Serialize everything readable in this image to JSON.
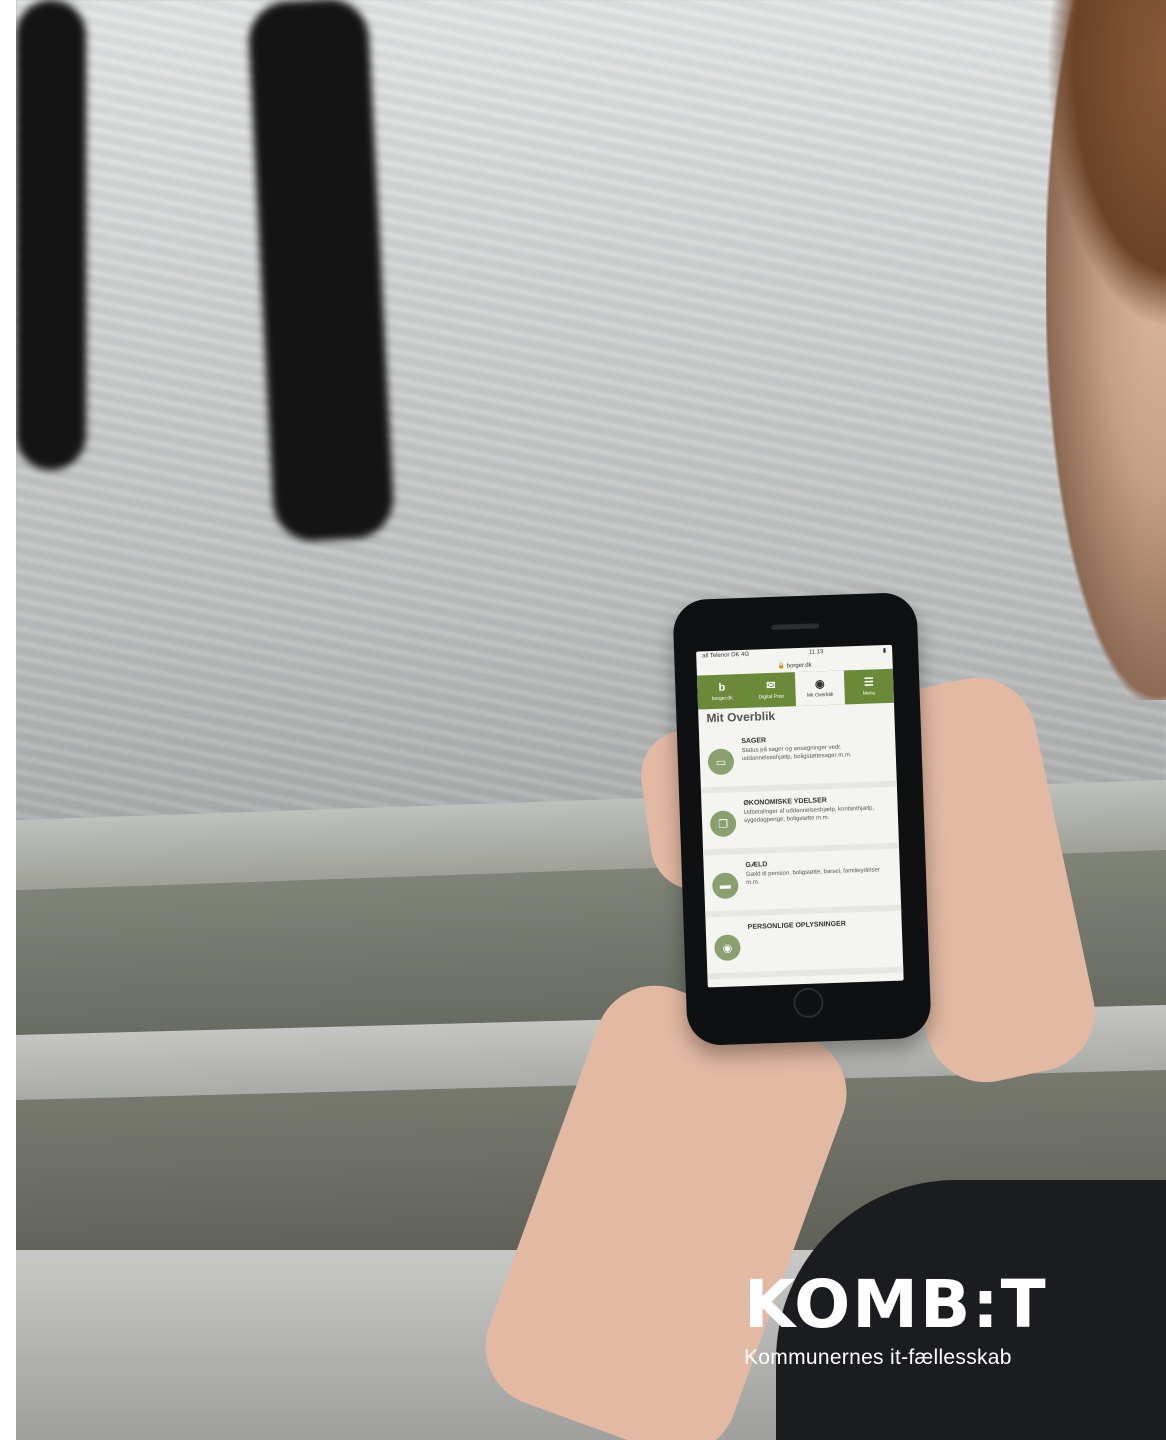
{
  "brand": {
    "logo_text": "KOMB:T",
    "tagline": "Kommunernes it-fællesskab"
  },
  "phone_screen": {
    "status_carrier": "all Telenor DK 4G",
    "status_time": "11.13",
    "url": "borger.dk",
    "nav": [
      {
        "label": "borger.dk",
        "icon": "b-logo-icon"
      },
      {
        "label": "Digital Post",
        "icon": "envelope-icon"
      },
      {
        "label": "Mit Overblik",
        "icon": "person-icon"
      },
      {
        "label": "Menu",
        "icon": "hamburger-icon"
      }
    ],
    "heading": "Mit Overblik",
    "cards": [
      {
        "title": "SAGER",
        "desc": "Status på sager og ansøgninger vedr. uddannelseshjælp, boligstøttesager m.m.",
        "icon": "folder-icon"
      },
      {
        "title": "ØKONOMISKE YDELSER",
        "desc": "Udbetalinger af uddannelseshjælp, kontanthjælp, sygedagpenge, boligstøtte m.m.",
        "icon": "coins-icon"
      },
      {
        "title": "GÆLD",
        "desc": "Gæld til pension, boligstøtte, barsel, familieydelser m.m.",
        "icon": "card-icon"
      },
      {
        "title": "PERSONLIGE OPLYSNINGER",
        "desc": "",
        "icon": "person-icon"
      }
    ]
  },
  "colors": {
    "nav_green": "#6a8a3a",
    "icon_green": "#8aa06e"
  }
}
